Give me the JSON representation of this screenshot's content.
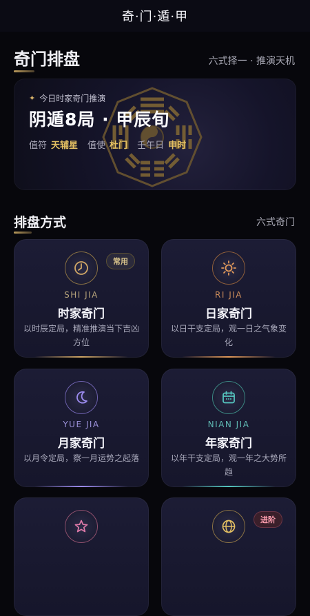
{
  "app": {
    "title": "奇·门·遁·甲"
  },
  "section1": {
    "title": "奇门排盘",
    "subtitle": "六式择一 · 推演天机"
  },
  "hero": {
    "kicker": "今日时家奇门推演",
    "title": "阴遁8局 · 甲辰旬",
    "zhifu_label": "值符",
    "zhifu_value": "天辅星",
    "zhishi_label": "值使",
    "zhishi_value": "杜门",
    "day_label": "壬午日",
    "hour_value": "申时"
  },
  "section2": {
    "title": "排盘方式",
    "subtitle": "六式奇门"
  },
  "cards": [
    {
      "pinyin": "SHI JIA",
      "name": "时家奇门",
      "desc": "以时辰定局，精准推演当下吉凶方位",
      "badge": "常用",
      "accent": "#d2a866",
      "icon": "clock-icon"
    },
    {
      "pinyin": "RI JIA",
      "name": "日家奇门",
      "desc": "以日干支定局，观一日之气象变化",
      "badge": "",
      "accent": "#e39a5a",
      "icon": "sun-icon"
    },
    {
      "pinyin": "YUE JIA",
      "name": "月家奇门",
      "desc": "以月令定局，察一月运势之起落",
      "badge": "",
      "accent": "#9d8cf0",
      "icon": "moon-icon"
    },
    {
      "pinyin": "NIAN JIA",
      "name": "年家奇门",
      "desc": "以年干支定局，观一年之大势所趋",
      "badge": "",
      "accent": "#55c7c0",
      "icon": "calendar-icon"
    },
    {
      "pinyin": "",
      "name": "",
      "desc": "",
      "badge": "",
      "accent": "#e07aa9",
      "icon": "star-icon"
    },
    {
      "pinyin": "",
      "name": "",
      "desc": "",
      "badge": "进阶",
      "accent": "#e3bf62",
      "icon": "globe-icon"
    }
  ]
}
